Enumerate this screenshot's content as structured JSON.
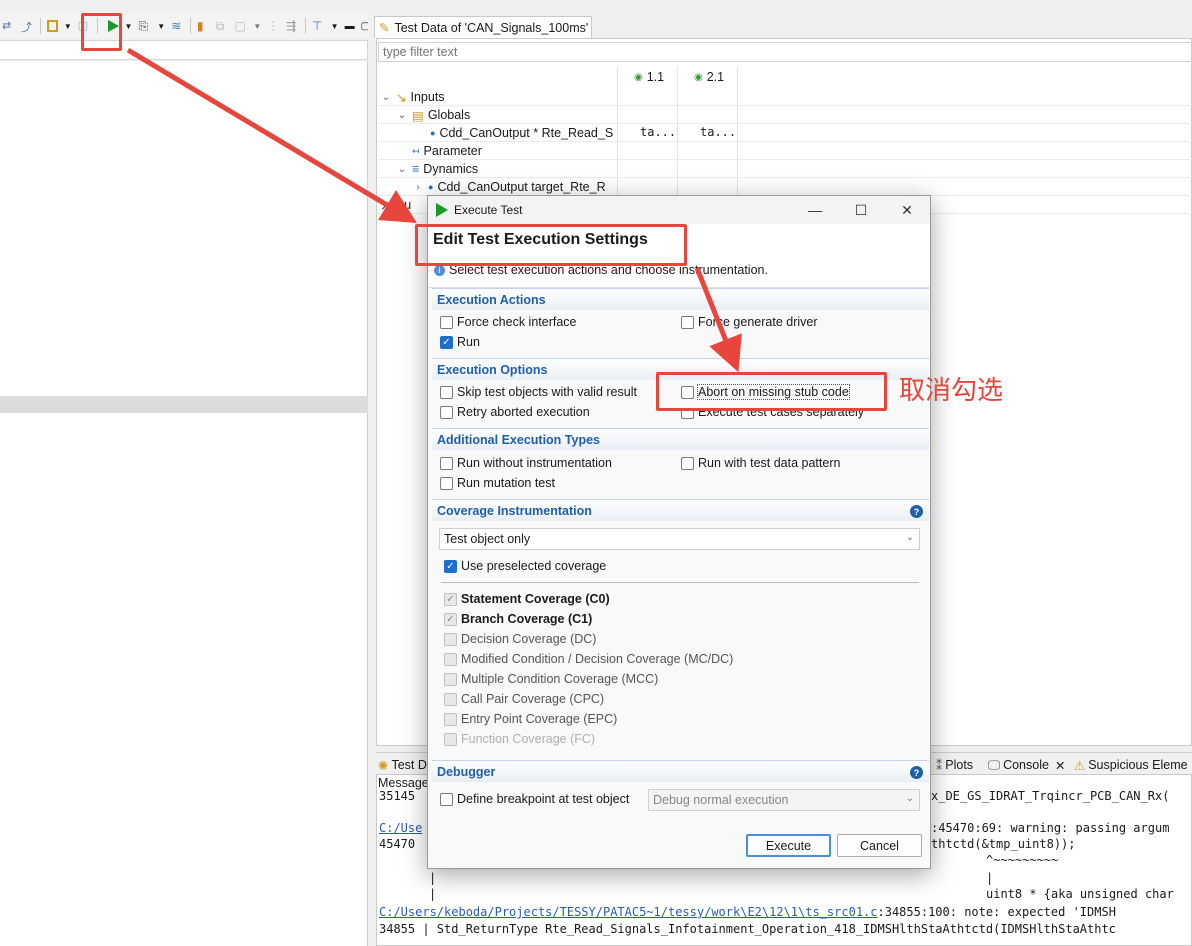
{
  "left_pane": {
    "filter_value": ""
  },
  "editor": {
    "tab_title": "Test Data of 'CAN_Signals_100ms'",
    "filter_placeholder": "type filter text",
    "columns": [
      "1.1",
      "2.1"
    ],
    "rows": [
      {
        "label": "Inputs",
        "level": 0,
        "expanded": true,
        "icon": "inputs-icon"
      },
      {
        "label": "Globals",
        "level": 1,
        "expanded": true,
        "icon": "globals-icon"
      },
      {
        "label": "Cdd_CanOutput * Rte_Read_S",
        "level": 2,
        "icon": "variable-icon",
        "values": [
          "ta...",
          "ta..."
        ]
      },
      {
        "label": "Parameter",
        "level": 1,
        "icon": "parameter-icon"
      },
      {
        "label": "Dynamics",
        "level": 1,
        "expanded": true,
        "icon": "dynamics-icon"
      },
      {
        "label": "Cdd_CanOutput target_Rte_R",
        "level": 2,
        "collapsed": true,
        "icon": "variable-icon"
      },
      {
        "label": "Ou",
        "level": 0,
        "icon": "outputs-icon"
      }
    ]
  },
  "bottom_tabs": {
    "test_tab": "Test D",
    "plots_tab": "Plots",
    "console_tab": "Console",
    "suspicious_tab": "Suspicious Eleme"
  },
  "console": {
    "header": "Message",
    "lines": [
      {
        "text": "35145",
        "tail": "x_DE_GS_IDRAT_Trqincr_PCB_CAN_Rx("
      },
      {
        "link": "C:/Use",
        "tail": ":45470:69: warning: passing argum"
      },
      {
        "text": "45470",
        "tail": "thtctd(&tmp_uint8));"
      },
      {
        "tail": "^~~~~~~~~~"
      },
      {
        "tail": "|"
      },
      {
        "tail": "uint8 * {aka unsigned char"
      },
      {
        "link": "C:/Users/keboda/Projects/TESSY/PATAC5~1/tessy/work\\E2\\12\\1\\ts_src01.c",
        "tail": ":34855:100: note: expected 'IDMSH"
      },
      {
        "text": "34855 | Std_ReturnType Rte_Read_Signals_Infotainment_Operation_418_IDMSHlthStaAthtctd(IDMSHlthStaAthtc"
      }
    ]
  },
  "dialog": {
    "window_title": "Execute Test",
    "heading": "Edit Test Execution Settings",
    "description": "Select test execution actions and choose instrumentation.",
    "sections": {
      "execution_actions": "Execution Actions",
      "execution_options": "Execution Options",
      "additional_types": "Additional Execution Types",
      "coverage": "Coverage Instrumentation",
      "debugger": "Debugger"
    },
    "actions": {
      "force_check_interface": {
        "label": "Force check interface",
        "checked": false
      },
      "force_generate_driver": {
        "label": "Force generate driver",
        "checked": false
      },
      "run": {
        "label": "Run",
        "checked": true
      }
    },
    "options": {
      "skip_valid": {
        "label": "Skip test objects with valid result",
        "checked": false
      },
      "abort_missing_stub": {
        "label": "Abort on missing stub code",
        "checked": false
      },
      "retry_aborted": {
        "label": "Retry aborted execution",
        "checked": false
      },
      "execute_separately": {
        "label": "Execute test cases separately",
        "checked": false
      }
    },
    "additional": {
      "without_instrumentation": {
        "label": "Run without instrumentation",
        "checked": false
      },
      "with_pattern": {
        "label": "Run with test data pattern",
        "checked": false
      },
      "mutation": {
        "label": "Run mutation test",
        "checked": false
      }
    },
    "coverage_select": "Test object only",
    "use_preselected": {
      "label": "Use preselected coverage",
      "checked": true
    },
    "coverages": [
      {
        "label": "Statement Coverage (C0)",
        "checked": true,
        "bold": true
      },
      {
        "label": "Branch Coverage (C1)",
        "checked": true,
        "bold": true
      },
      {
        "label": "Decision Coverage (DC)",
        "checked": false
      },
      {
        "label": "Modified Condition / Decision Coverage (MC/DC)",
        "checked": false
      },
      {
        "label": "Multiple Condition Coverage (MCC)",
        "checked": false
      },
      {
        "label": "Call Pair Coverage (CPC)",
        "checked": false
      },
      {
        "label": "Entry Point Coverage (EPC)",
        "checked": false
      },
      {
        "label": "Function Coverage (FC)",
        "checked": false,
        "faded": true
      }
    ],
    "debugger": {
      "define_breakpoint": {
        "label": "Define breakpoint at test object",
        "checked": false
      },
      "debug_mode": "Debug normal execution"
    },
    "buttons": {
      "execute": "Execute",
      "cancel": "Cancel"
    }
  },
  "annotation": {
    "note": "取消勾选",
    "color": "#e8453c"
  },
  "colors": {
    "section_text": "#1f5faa",
    "checkbox_on": "#1d6fc9",
    "run_icon": "#1a9a2a"
  }
}
